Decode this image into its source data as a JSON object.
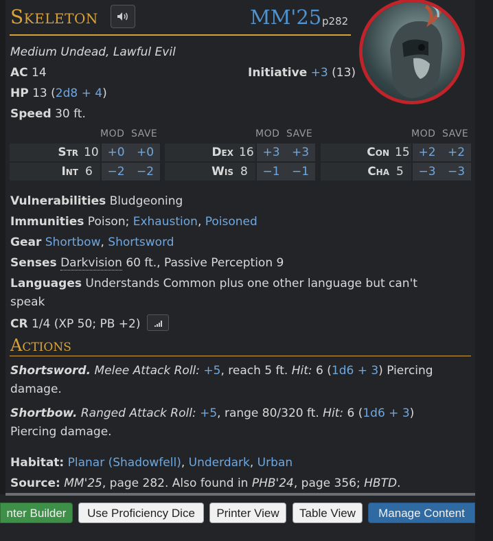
{
  "header": {
    "name": "Skeleton",
    "source_abbr": "MM'25",
    "source_page": "p282"
  },
  "meta": {
    "type_line": "Medium Undead, Lawful Evil",
    "ac_label": "AC",
    "ac_value": "14",
    "initiative_label": "Initiative",
    "initiative_mod": "+3",
    "initiative_score": "(13)",
    "hp_label": "HP",
    "hp_value": "13",
    "hp_formula": "2d8 + 4",
    "speed_label": "Speed",
    "speed_value": "30 ft."
  },
  "abilities": {
    "mod_label": "MOD",
    "save_label": "SAVE",
    "blocks": [
      [
        {
          "name": "Str",
          "score": "10",
          "mod": "+0",
          "save": "+0"
        },
        {
          "name": "Int",
          "score": "6",
          "mod": "−2",
          "save": "−2"
        }
      ],
      [
        {
          "name": "Dex",
          "score": "16",
          "mod": "+3",
          "save": "+3"
        },
        {
          "name": "Wis",
          "score": "8",
          "mod": "−1",
          "save": "−1"
        }
      ],
      [
        {
          "name": "Con",
          "score": "15",
          "mod": "+2",
          "save": "+2"
        },
        {
          "name": "Cha",
          "score": "5",
          "mod": "−3",
          "save": "−3"
        }
      ]
    ]
  },
  "traits": {
    "vuln_label": "Vulnerabilities",
    "vuln_value": "Bludgeoning",
    "imm_label": "Immunities",
    "imm_text": "Poison;",
    "imm_links": [
      "Exhaustion",
      "Poisoned"
    ],
    "gear_label": "Gear",
    "gear_links": [
      "Shortbow",
      "Shortsword"
    ],
    "senses_label": "Senses",
    "senses_link": "Darkvision",
    "senses_text": "60 ft., Passive Perception 9",
    "lang_label": "Languages",
    "lang_line1": "Understands Common plus one other language but can't",
    "lang_line2": "speak",
    "cr_label": "CR",
    "cr_value": "1/4 (XP 50; PB +2)"
  },
  "actions": {
    "title": "Actions",
    "items": [
      {
        "name": "Shortsword.",
        "type": "Melee Attack Roll:",
        "bonus": "+5",
        "reach": ", reach 5 ft.",
        "hit_label": "Hit:",
        "hit_value": "6",
        "dice": "1d6 + 3",
        "damage_line1": ") Piercing",
        "damage_line2": "damage."
      },
      {
        "name": "Shortbow.",
        "type": "Ranged Attack Roll:",
        "bonus": "+5",
        "reach": ", range 80/320 ft.",
        "hit_label": "Hit:",
        "hit_value": "6",
        "dice": "1d6 + 3",
        "damage_line1": ")",
        "damage_line2": "Piercing damage."
      }
    ]
  },
  "footer": {
    "habitat_label": "Habitat:",
    "habitat_links": [
      "Planar (Shadowfell)",
      "Underdark",
      "Urban"
    ],
    "source_label": "Source:",
    "source_book1": "MM'25",
    "source_text1": ", page 282. Also found in",
    "source_book2": "PHB'24",
    "source_text2": ", page 356;",
    "source_book3": "HBTD",
    "source_text3": "."
  },
  "buttons": {
    "builder": "nter Builder",
    "proficiency": "Use Proficiency Dice",
    "printer": "Printer View",
    "table": "Table View",
    "manage": "Manage Content"
  },
  "colors": {
    "accent_gold": "#d9a33a",
    "link_blue": "#6fa8e0",
    "portrait_ring": "#c0242a"
  }
}
